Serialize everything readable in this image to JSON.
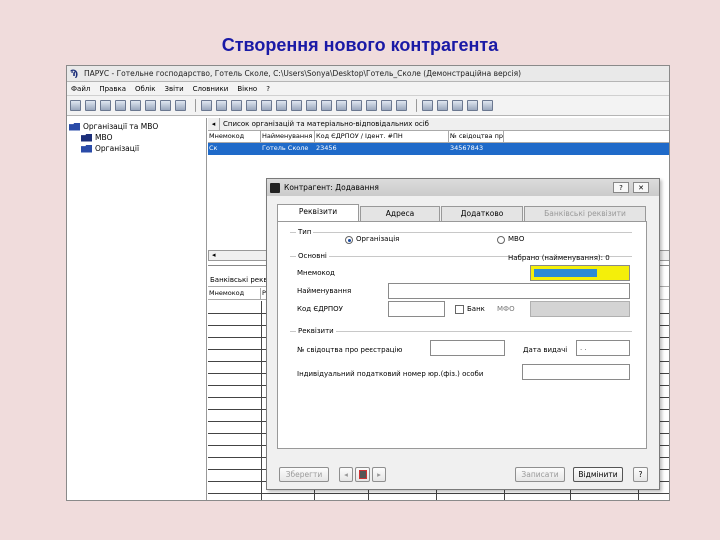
{
  "slide_title": "Створення нового контрагента",
  "app": {
    "title": "ПАРУС - Готельне господарство, Готель Сколе, C:\\Users\\Sonya\\Desktop\\Готель_Сколе (Демонстраційна версія)",
    "menu": [
      "Файл",
      "Правка",
      "Облік",
      "Звіти",
      "Словники",
      "Вікно",
      "?"
    ]
  },
  "tree": {
    "root": "Організації та МВО",
    "items": [
      "МВО",
      "Організації"
    ]
  },
  "list_pane": {
    "title": "Список організацій та матеріально-відповідальних осіб",
    "columns": [
      "Мнемокод",
      "Найменування",
      "Код ЄДРПОУ / Ідент. #ПН",
      "№ свідоцтва пр"
    ],
    "row": [
      "Ск",
      "Готель Сколе",
      "23456",
      "34567843"
    ]
  },
  "bank_pane": {
    "title": "Банківські рекв",
    "columns": [
      "Мнемокод",
      "Р"
    ]
  },
  "dialog": {
    "title": "Контрагент: Додавання",
    "help_btn": "?",
    "close_btn": "✕",
    "tabs": [
      "Реквізити",
      "Адреса",
      "Додатково",
      "Банківські реквізити"
    ],
    "type_group": "Тип",
    "type_org": "Організація",
    "type_mvo": "МВО",
    "main_group": "Основні",
    "typed_count": "Набрано (найменування): 0",
    "mnemo_label": "Мнемокод",
    "name_label": "Найменування",
    "edrpou_label": "Код ЄДРПОУ",
    "bank_label": "Банк",
    "mfo_label": "МФО",
    "req_group": "Реквізити",
    "reg_cert_label": "№ свідоцтва про реєстрацію",
    "issue_date_label": "Дата видачі",
    "issue_date_value": ". .",
    "tax_num_label": "Індивідуальний податковий номер юр.(фіз.) особи",
    "save_btn": "Зберегти",
    "nav_prev": "◂",
    "nav_next": "▸",
    "write_btn": "Записати",
    "cancel_btn": "Відмінити",
    "help_footer": "?"
  }
}
